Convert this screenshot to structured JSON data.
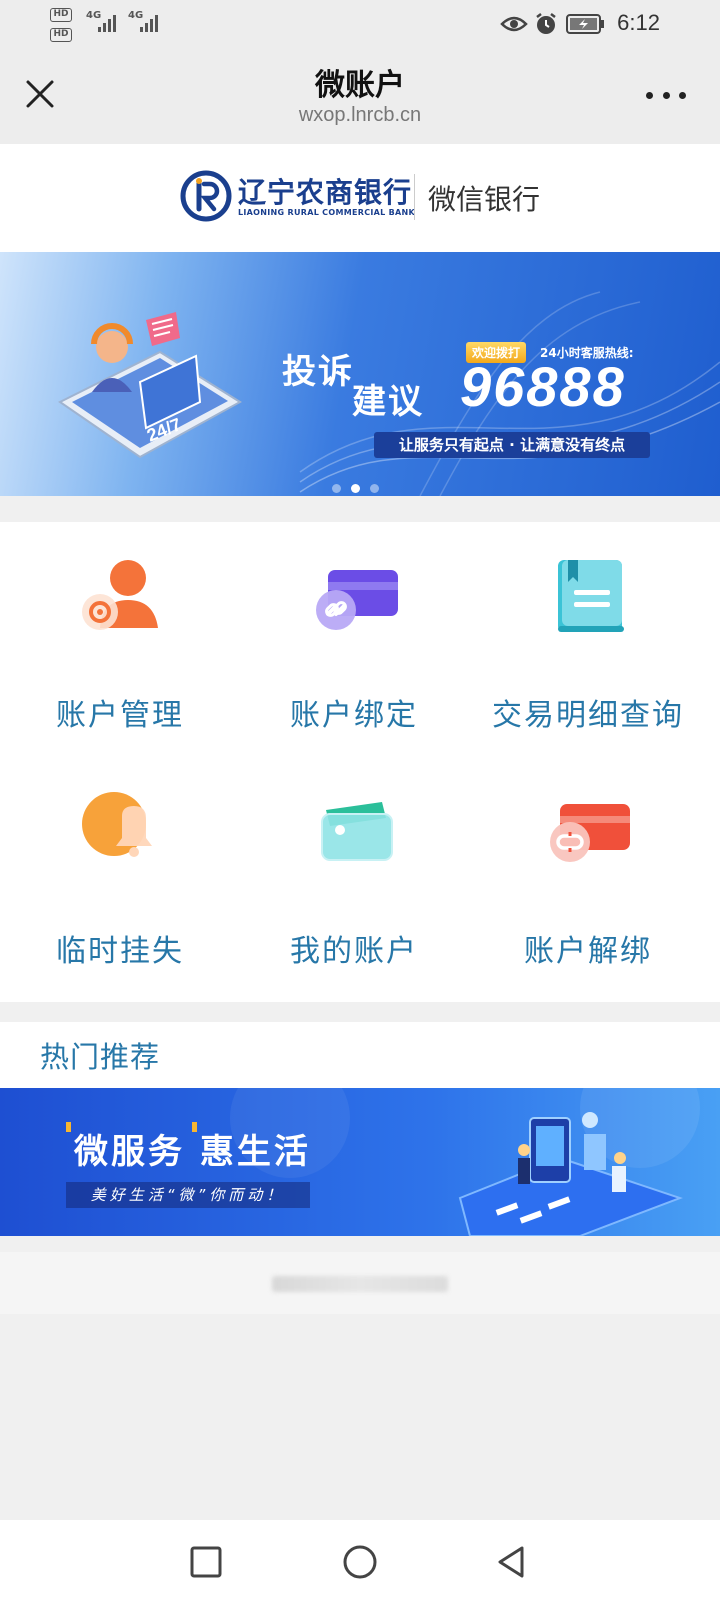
{
  "status_bar": {
    "hd_badge": "HD",
    "network_1": "4G",
    "network_2": "4G",
    "time": "6:12",
    "icons": [
      "eye-icon",
      "alarm-icon",
      "battery-charging-icon"
    ]
  },
  "title_bar": {
    "title": "微账户",
    "url": "wxop.lnrcb.cn",
    "close_icon": "close-icon",
    "more_icon": "more-icon"
  },
  "logo": {
    "bank_name": "辽宁农商银行",
    "bank_name_en": "LIAONING RURAL COMMERCIAL BANK",
    "channel": "微信银行"
  },
  "hero_banner": {
    "headline_1": "投诉",
    "headline_2": "建议",
    "badge": "欢迎拨打",
    "hotline_label": "24小时客服热线:",
    "hotline": "96888",
    "slogan": "让服务只有起点 · 让满意没有终点",
    "active_slide": 2,
    "slide_count": 3
  },
  "services": [
    {
      "label": "账户管理",
      "icon": "account-management-icon"
    },
    {
      "label": "账户绑定",
      "icon": "card-link-icon"
    },
    {
      "label": "交易明细查询",
      "icon": "book-icon"
    },
    {
      "label": "临时挂失",
      "icon": "bell-icon"
    },
    {
      "label": "我的账户",
      "icon": "wallet-icon"
    },
    {
      "label": "账户解绑",
      "icon": "card-unlink-icon"
    }
  ],
  "recommend": {
    "title": "热门推荐",
    "promo_title": "微服务 惠生活",
    "promo_subtitle": "美好生活“微”你而动！"
  },
  "colors": {
    "accent": "#2777a8",
    "brand": "#1a3f8e",
    "banner_blue": "#1f5ecf"
  }
}
